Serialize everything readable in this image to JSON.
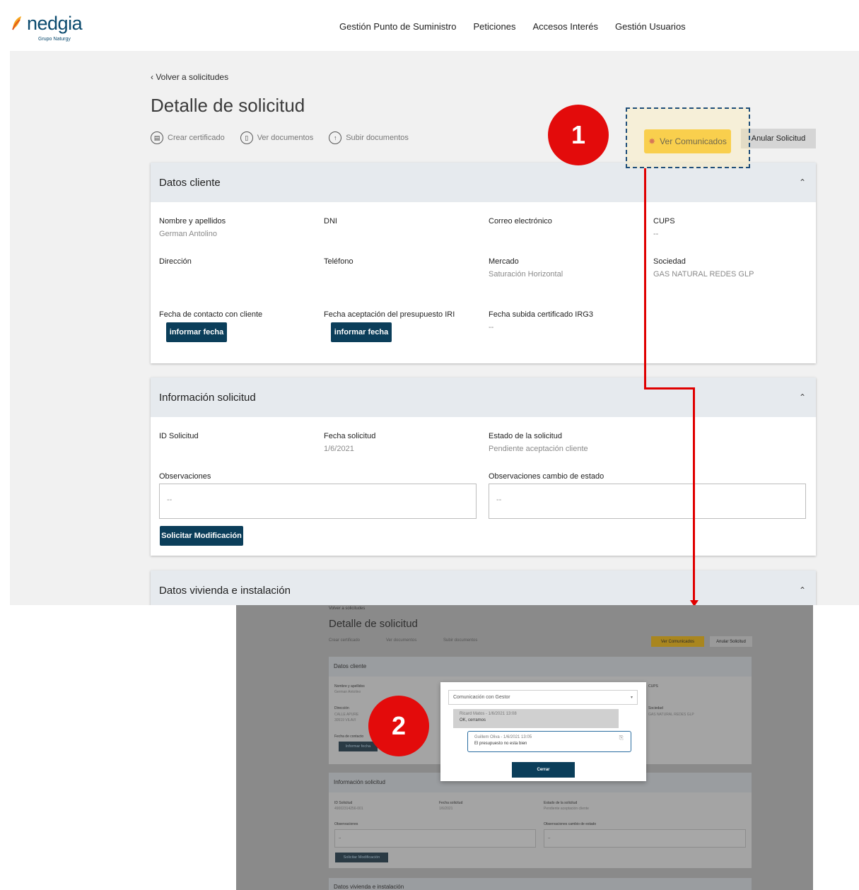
{
  "brand": {
    "name": "nedgia",
    "subtitle": "Grupo Naturgy",
    "colors": {
      "primary": "#0b3e5a",
      "accent": "#f6c11d",
      "annotation": "#e30b0b"
    }
  },
  "nav": [
    "Gestión Punto de Suministro",
    "Peticiones",
    "Accesos Interés",
    "Gestión Usuarios"
  ],
  "page": {
    "back_link": "Volver a solicitudes",
    "title": "Detalle de solicitud",
    "actions": [
      {
        "label": "Crear certificado",
        "icon": "certificate-icon"
      },
      {
        "label": "Ver documentos",
        "icon": "document-icon"
      },
      {
        "label": "Subir documentos",
        "icon": "upload-icon"
      }
    ],
    "btn_comunicados": "Ver Comunicados",
    "btn_anular": "Anular Solicitud"
  },
  "annotations": {
    "badge_1": "1",
    "badge_2": "2"
  },
  "datos_cliente": {
    "title": "Datos cliente",
    "fields": [
      {
        "label": "Nombre y apellidos",
        "value": "German Antolino"
      },
      {
        "label": "DNI",
        "value": ""
      },
      {
        "label": "Correo electrónico",
        "value": ""
      },
      {
        "label": "CUPS",
        "value": "--"
      },
      {
        "label": "Dirección",
        "value": ""
      },
      {
        "label": "Teléfono",
        "value": ""
      },
      {
        "label": "Mercado",
        "value": "Saturación Horizontal"
      },
      {
        "label": "Sociedad",
        "value": "GAS NATURAL REDES GLP"
      },
      {
        "label": "Fecha de contacto con cliente",
        "value": ""
      },
      {
        "label": "Fecha aceptación del presupuesto IRI",
        "value": ""
      },
      {
        "label": "Fecha subida certificado IRG3",
        "value": "--"
      }
    ],
    "btn_informar": "informar fecha"
  },
  "info_solicitud": {
    "title": "Información solicitud",
    "fields": [
      {
        "label": "ID Solicitud",
        "value": ""
      },
      {
        "label": "Fecha solicitud",
        "value": "1/6/2021"
      },
      {
        "label": "Estado de la solicitud",
        "value": "Pendiente aceptación cliente"
      }
    ],
    "observaciones_label": "Observaciones",
    "observaciones_value": "--",
    "obs_cambio_label": "Observaciones cambio de estado",
    "obs_cambio_value": "--",
    "btn_modificacion": "Solicitar Modificación"
  },
  "datos_vivienda": {
    "title": "Datos vivienda e instalación"
  },
  "screenshot2": {
    "back_link": "Volver a solicitudes",
    "title": "Detalle de solicitud",
    "actions": [
      "Crear certificado",
      "Ver documentos",
      "Subir documentos"
    ],
    "btn_comunicados": "Ver Comunicados",
    "btn_anular": "Anular Solicitud",
    "datos_cliente_title": "Datos cliente",
    "nombre_label": "Nombre y apellidos",
    "nombre_value": "German Antolino",
    "direccion_label": "Dirección",
    "direccion_value_1": "CALLE APURE",
    "direccion_value_2": "30519 VILAVI",
    "fecha_contacto_label": "Fecha de contacto",
    "btn_informar": "Informar fecha",
    "cups_label": "CUPS",
    "sociedad_label": "Sociedad",
    "sociedad_value": "GAS NATURAL REDES GLP",
    "info_title": "Información solicitud",
    "id_label": "ID Solicitud",
    "id_value": "49002314256-001",
    "fecha_label": "Fecha solicitud",
    "fecha_value": "1/6/2021",
    "estado_label": "Estado de la solicitud",
    "estado_value": "Pendiente aceptación cliente",
    "obs_label": "Observaciones",
    "obs_value": "--",
    "obs_cambio_label": "Observaciones cambio de estado",
    "obs_cambio_value": "--",
    "btn_modificacion": "Solicitar Modificación",
    "vivienda_title": "Datos vivienda e instalación",
    "modal": {
      "select_value": "Comunicación con Gestor",
      "messages": [
        {
          "meta": "Ricard Matos - 1/6/2021 13:08",
          "text": "OK, cerramos"
        },
        {
          "meta": "Guillem Oliva - 1/6/2021 13:05",
          "text": "El presupuesto no esta bien"
        }
      ],
      "close_label": "Cerrar"
    }
  }
}
